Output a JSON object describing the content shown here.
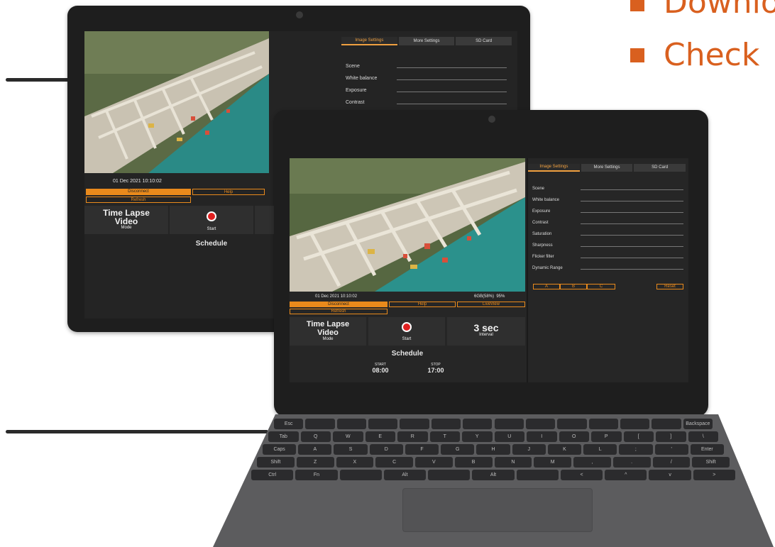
{
  "bullets": [
    "Downlo",
    "Check"
  ],
  "back_device": {
    "tabs": [
      "Image Settings",
      "More Settings",
      "SD Card"
    ],
    "settings": [
      "Scene",
      "White balance",
      "Exposure",
      "Contrast"
    ],
    "timestamp": "01 Dec 2021 10:10:02",
    "buttons": {
      "disconnect": "Disconnect",
      "help": "Help",
      "refresh": "Refresh"
    },
    "mode_title": "Time Lapse Video",
    "mode_label": "Mode",
    "start_label": "Start",
    "schedule": "Schedule"
  },
  "front_device": {
    "tabs": [
      "Image Settings",
      "More Settings",
      "SD Card"
    ],
    "settings": [
      "Scene",
      "White balance",
      "Exposure",
      "Contrast",
      "Saturation",
      "Sharpness",
      "Flicker filter",
      "Dynamic Range"
    ],
    "abc": [
      "A",
      "B",
      "C"
    ],
    "reset": "Reset",
    "timestamp": "01 Dec 2021 10:10:02",
    "storage": "6GB(58%)  95%",
    "buttons": {
      "disconnect": "Disconnect",
      "help": "Help",
      "liveview": "LiveView",
      "refresh": "Refresh"
    },
    "mode_title": "Time Lapse Video",
    "mode_label": "Mode",
    "start_label": "Start",
    "interval_value": "3 sec",
    "interval_label": "Interval",
    "schedule": "Schedule",
    "start_time_label": "START",
    "start_time": "08:00",
    "stop_time_label": "STOP",
    "stop_time": "17:00"
  },
  "keyboard": {
    "row1": [
      "Esc",
      "",
      "",
      "",
      "",
      "",
      "",
      "",
      "",
      "",
      "",
      "",
      "",
      "Backspace"
    ],
    "row2": [
      "Tab",
      "Q",
      "W",
      "E",
      "R",
      "T",
      "Y",
      "U",
      "I",
      "O",
      "P",
      "[",
      "]",
      "\\"
    ],
    "row3": [
      "Caps",
      "A",
      "S",
      "D",
      "F",
      "G",
      "H",
      "J",
      "K",
      "L",
      ";",
      "'",
      "Enter"
    ],
    "row4": [
      "Shift",
      "Z",
      "X",
      "C",
      "V",
      "B",
      "N",
      "M",
      ",",
      ".",
      "/",
      "Shift"
    ],
    "row5": [
      "Ctrl",
      "Fn",
      "",
      "Alt",
      "",
      "Alt",
      "",
      "<",
      "^",
      "v",
      ">"
    ]
  }
}
